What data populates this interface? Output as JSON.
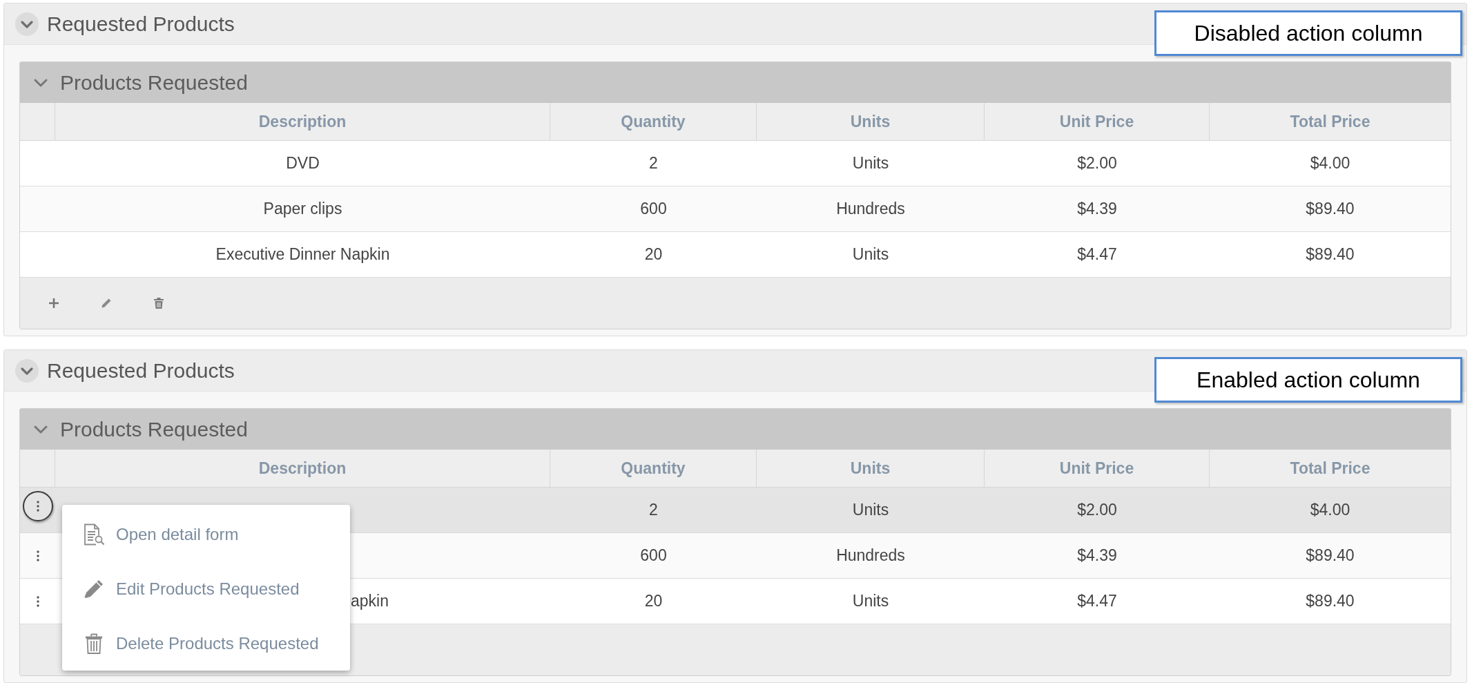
{
  "panels": [
    {
      "title": "Requested Products",
      "callout": "Disabled action column",
      "actions_enabled": false,
      "table": {
        "title": "Products Requested",
        "columns": [
          "Description",
          "Quantity",
          "Units",
          "Unit Price",
          "Total Price"
        ],
        "rows": [
          {
            "cells": [
              "DVD",
              "2",
              "Units",
              "$2.00",
              "$4.00"
            ],
            "selected": false
          },
          {
            "cells": [
              "Paper clips",
              "600",
              "Hundreds",
              "$4.39",
              "$89.40"
            ],
            "selected": false
          },
          {
            "cells": [
              "Executive Dinner Napkin",
              "20",
              "Units",
              "$4.47",
              "$89.40"
            ],
            "selected": false
          }
        ],
        "toolbar": [
          {
            "kind": "add"
          },
          {
            "kind": "edit"
          },
          {
            "kind": "delete"
          }
        ]
      }
    },
    {
      "title": "Requested Products",
      "callout": "Enabled action column",
      "actions_enabled": true,
      "table": {
        "title": "Products Requested",
        "columns": [
          "Description",
          "Quantity",
          "Units",
          "Unit Price",
          "Total Price"
        ],
        "rows": [
          {
            "cells": [
              null,
              "2",
              "Units",
              "$2.00",
              "$4.00"
            ],
            "selected": true,
            "menu_open": true
          },
          {
            "cells": [
              null,
              "600",
              "Hundreds",
              "$4.39",
              "$89.40"
            ],
            "selected": false,
            "menu_open": false
          },
          {
            "cells": [
              "apkin",
              "20",
              "Units",
              "$4.47",
              "$89.40"
            ],
            "selected": false,
            "menu_open": false
          }
        ]
      },
      "row_menu": [
        {
          "kind": "detail",
          "label": "Open detail form"
        },
        {
          "kind": "edit",
          "label": "Edit Products Requested"
        },
        {
          "kind": "delete",
          "label": "Delete Products Requested"
        }
      ]
    }
  ]
}
